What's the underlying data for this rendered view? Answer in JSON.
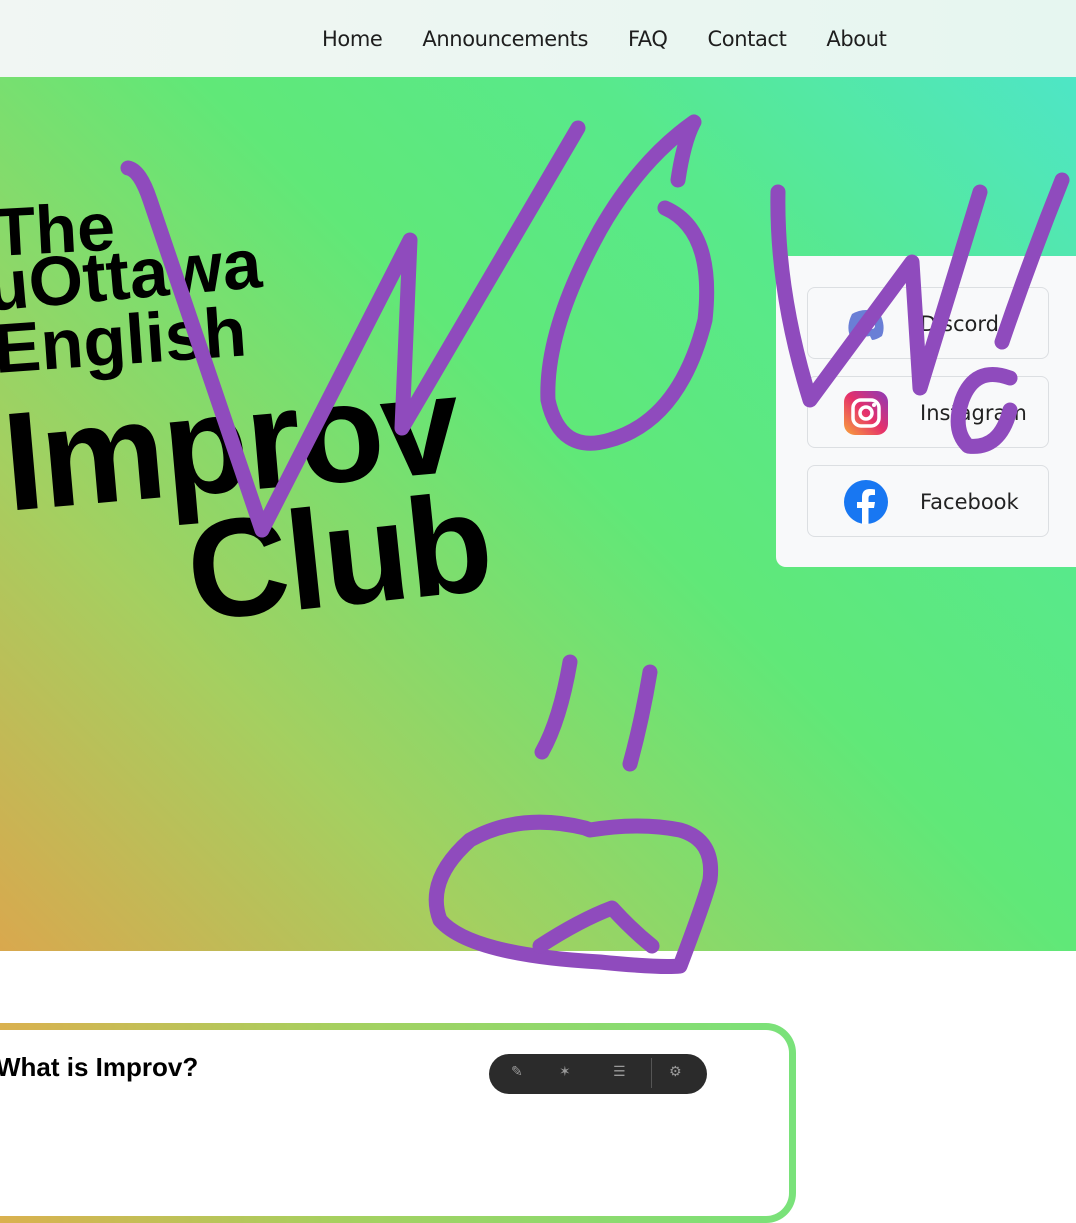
{
  "nav": {
    "items": [
      "Home",
      "Announcements",
      "FAQ",
      "Contact",
      "About"
    ]
  },
  "hero": {
    "title_lines": [
      "The",
      "uOttawa",
      "English",
      "Improv",
      "Club"
    ]
  },
  "social": {
    "buttons": [
      {
        "label": "Discord",
        "icon": "discord-icon"
      },
      {
        "label": "Instagram",
        "icon": "instagram-icon"
      },
      {
        "label": "Facebook",
        "icon": "facebook-icon"
      }
    ]
  },
  "about": {
    "heading": "What is Improv?"
  },
  "annotation": {
    "text": "WOW!",
    "color": "#8f4bbd"
  },
  "colors": {
    "discord": "#6a7fd6",
    "instagram": "#d6246e",
    "facebook": "#1877f2"
  }
}
